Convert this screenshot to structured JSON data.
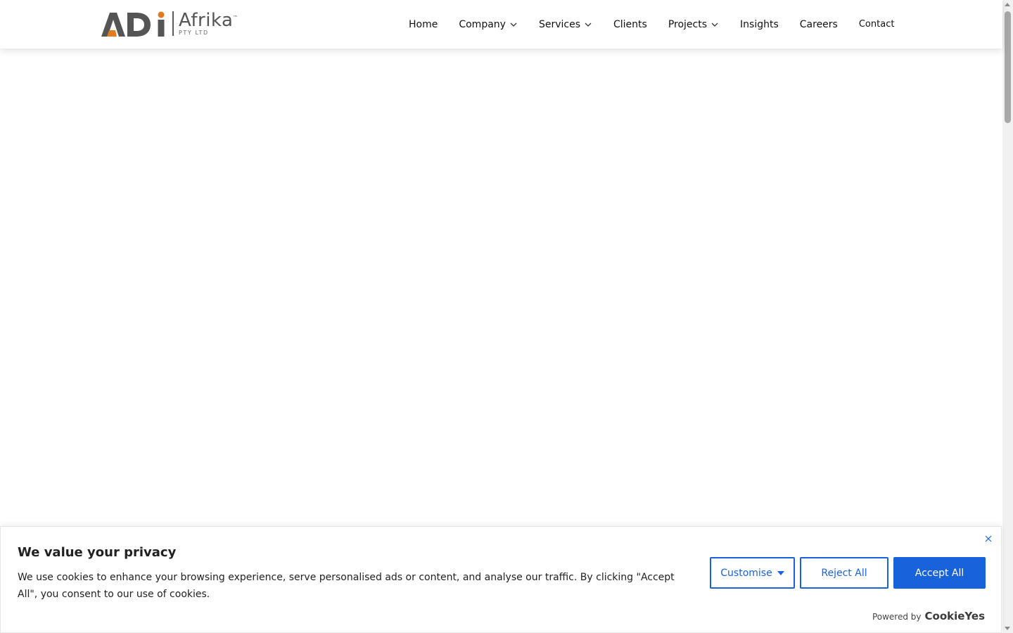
{
  "header": {
    "logo": {
      "mark_text": "ADi",
      "brand": "Afrika",
      "trademark": "™",
      "subtitle": "PTY LTD"
    },
    "nav": [
      {
        "label": "Home",
        "dropdown": false
      },
      {
        "label": "Company",
        "dropdown": true
      },
      {
        "label": "Services",
        "dropdown": true
      },
      {
        "label": "Clients",
        "dropdown": false
      },
      {
        "label": "Projects",
        "dropdown": true
      },
      {
        "label": "Insights",
        "dropdown": false
      },
      {
        "label": "Careers",
        "dropdown": false
      },
      {
        "label": "Contact",
        "dropdown": false
      }
    ]
  },
  "cookie_banner": {
    "title": "We value your privacy",
    "text": "We use cookies to enhance your browsing experience, serve personalised ads or content, and analyse our traffic. By clicking \"Accept All\", you consent to our use of cookies.",
    "customise_label": "Customise",
    "reject_label": "Reject All",
    "accept_label": "Accept All",
    "powered_by": "Powered by",
    "powered_brand": "CookieYes"
  },
  "colors": {
    "accent": "#1863dc",
    "logo_orange": "#e07b22",
    "logo_gray": "#555555"
  },
  "icons": [
    "chevron-down-icon",
    "close-icon",
    "caret-down-icon",
    "scroll-up-arrow-icon",
    "scroll-down-arrow-icon"
  ]
}
